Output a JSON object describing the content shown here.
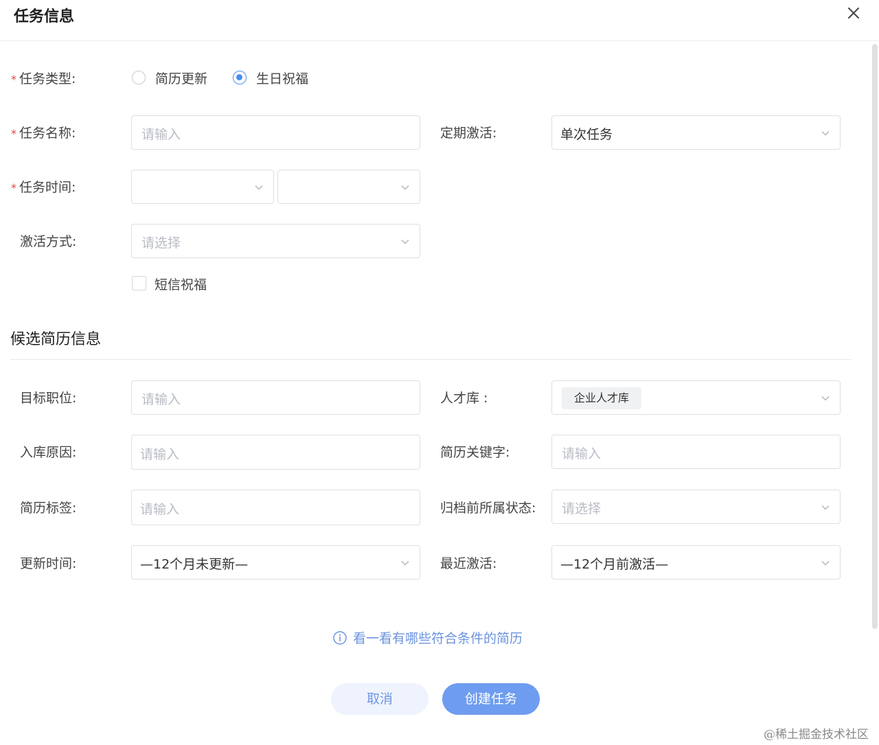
{
  "dialog": {
    "title": "任务信息"
  },
  "task_info": {
    "task_type": {
      "label": "任务类型:",
      "options": [
        "简历更新",
        "生日祝福"
      ],
      "selected": "生日祝福"
    },
    "task_name": {
      "label": "任务名称:",
      "placeholder": "请输入"
    },
    "periodic_activation": {
      "label": "定期激活:",
      "value": "单次任务"
    },
    "task_time": {
      "label": "任务时间:"
    },
    "activation_method": {
      "label": "激活方式:",
      "placeholder": "请选择"
    },
    "sms_greeting": {
      "label": "短信祝福",
      "checked": false
    }
  },
  "candidate": {
    "section_title": "候选简历信息",
    "target_position": {
      "label": "目标职位:",
      "placeholder": "请输入"
    },
    "talent_pool": {
      "label": "人才库 :",
      "tag": "企业人才库"
    },
    "storage_reason": {
      "label": "入库原因:",
      "placeholder": "请输入"
    },
    "resume_keywords": {
      "label": "简历关键字:",
      "placeholder": "请输入"
    },
    "resume_tags": {
      "label": "简历标签:",
      "placeholder": "请输入"
    },
    "archive_status": {
      "label": "归档前所属状态:",
      "placeholder": "请选择"
    },
    "update_time": {
      "label": "更新时间:",
      "value": "—12个月未更新—"
    },
    "recent_activation": {
      "label": "最近激活:",
      "value": "—12个月前激活—"
    }
  },
  "tip_link": "看一看有哪些符合条件的简历",
  "buttons": {
    "cancel": "取消",
    "create": "创建任务"
  },
  "credit": "@稀土掘金技术社区",
  "colors": {
    "accent": "#4a8cf2",
    "required": "#e0433e",
    "link": "#6b93e0"
  }
}
